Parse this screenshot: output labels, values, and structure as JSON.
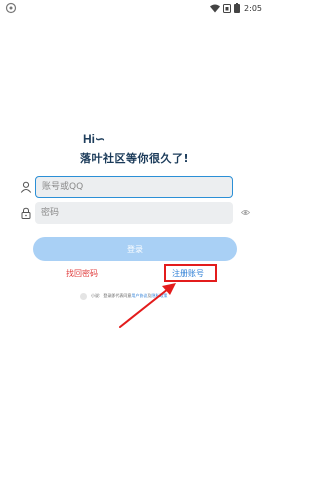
{
  "status_bar": {
    "time": "2:05",
    "icons": [
      "wifi-icon",
      "sim-icon",
      "battery-icon"
    ]
  },
  "header": {
    "logo_text": "Hi∽",
    "welcome": "落叶社区等你很久了!"
  },
  "form": {
    "account_placeholder": "账号或QQ",
    "password_placeholder": "密码"
  },
  "actions": {
    "login_label": "登录",
    "forgot_label": "找回密码",
    "register_label": "注册账号"
  },
  "agreement": {
    "prefix_text": "小说:",
    "body_text": "登录即代表同意",
    "user_agreement": "用户协议",
    "separator": "及",
    "privacy_policy": "隐私政策"
  },
  "colors": {
    "accent": "#2b8fd6",
    "login_button": "#a9d0f5",
    "forgot_text": "#e03b3b",
    "register_text": "#2c7ed6",
    "annotation": "#e31c1c"
  }
}
